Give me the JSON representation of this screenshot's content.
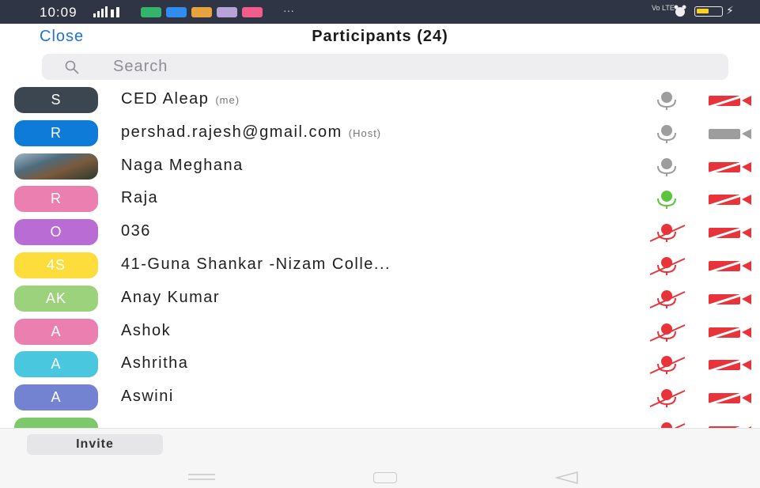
{
  "status_bar": {
    "time": "10:09",
    "more": "···",
    "volte": "Vo LTE"
  },
  "header": {
    "close_label": "Close",
    "title": "Participants (24)"
  },
  "search": {
    "placeholder": "Search"
  },
  "colors": {
    "accent": "#1f73d3",
    "muted_red": "#e8333b",
    "mic_gray": "#9d9d9d",
    "mic_green": "#5cc43a"
  },
  "participants": [
    {
      "initials": "S",
      "avatar_color": "#3b4650",
      "name": "CED Aleap",
      "tag": "(me)",
      "mic": "gray",
      "cam": "off"
    },
    {
      "initials": "R",
      "avatar_color": "#0e7bd8",
      "name": "pershad.rajesh@gmail.com",
      "tag": "(Host)",
      "mic": "gray",
      "cam": "on"
    },
    {
      "initials": "",
      "avatar_color": "photo",
      "name": "Naga Meghana",
      "tag": "",
      "mic": "gray",
      "cam": "off"
    },
    {
      "initials": "R",
      "avatar_color": "#ea7fb0",
      "name": "Raja",
      "tag": "",
      "mic": "green",
      "cam": "off"
    },
    {
      "initials": "O",
      "avatar_color": "#b86cd4",
      "name": "036",
      "tag": "",
      "mic": "muted",
      "cam": "off"
    },
    {
      "initials": "4S",
      "avatar_color": "#fddd3c",
      "name": "41-Guna Shankar -Nizam Colle...",
      "tag": "",
      "mic": "muted",
      "cam": "off"
    },
    {
      "initials": "AK",
      "avatar_color": "#9cd27c",
      "name": "Anay Kumar",
      "tag": "",
      "mic": "muted",
      "cam": "off"
    },
    {
      "initials": "A",
      "avatar_color": "#ea7fb0",
      "name": "Ashok",
      "tag": "",
      "mic": "muted",
      "cam": "off"
    },
    {
      "initials": "A",
      "avatar_color": "#48c7df",
      "name": "Ashritha",
      "tag": "",
      "mic": "muted",
      "cam": "off"
    },
    {
      "initials": "A",
      "avatar_color": "#7482d2",
      "name": "Aswini",
      "tag": "",
      "mic": "muted",
      "cam": "off"
    },
    {
      "initials": "",
      "avatar_color": "#7cc86a",
      "name": "",
      "tag": "",
      "mic": "muted",
      "cam": "off"
    }
  ],
  "footer": {
    "invite_label": "Invite"
  }
}
